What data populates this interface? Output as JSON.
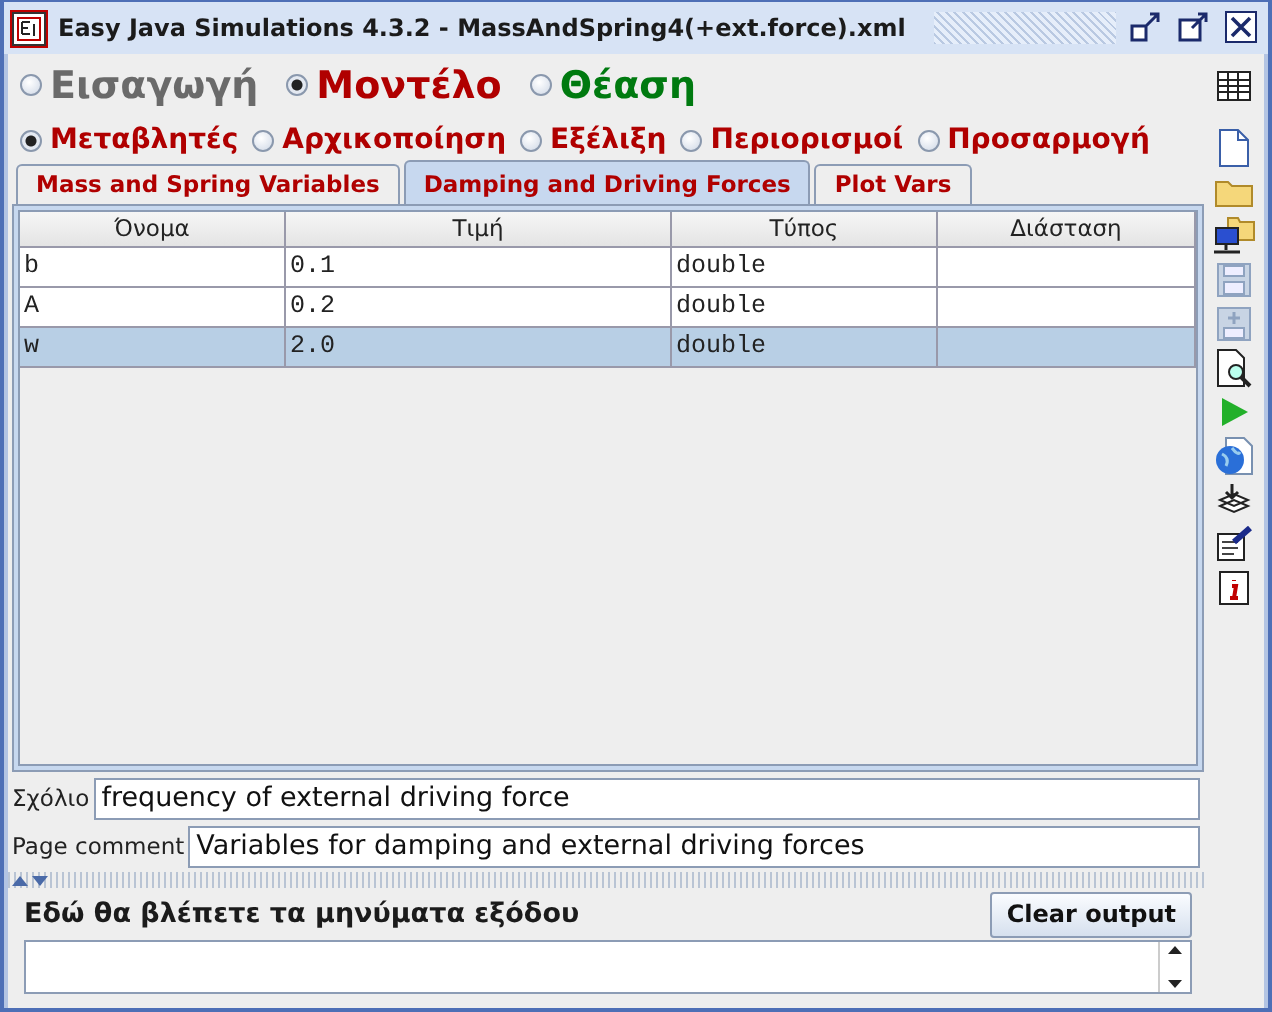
{
  "window": {
    "title": "Easy Java Simulations 4.3.2 - MassAndSpring4(+ext.force).xml"
  },
  "perspectives": [
    {
      "label": "Εισαγωγή",
      "selected": false,
      "color": "#6a6a6a"
    },
    {
      "label": "Μοντέλο",
      "selected": true,
      "color": "#b00000"
    },
    {
      "label": "Θέαση",
      "selected": false,
      "color": "#007a10"
    }
  ],
  "sections": [
    {
      "label": "Μεταβλητές",
      "selected": true
    },
    {
      "label": "Αρχικοποίηση",
      "selected": false
    },
    {
      "label": "Εξέλιξη",
      "selected": false
    },
    {
      "label": "Περιορισμοί",
      "selected": false
    },
    {
      "label": "Προσαρμογή",
      "selected": false
    }
  ],
  "tabs": [
    {
      "label": "Mass and Spring Variables",
      "selected": false
    },
    {
      "label": "Damping and Driving Forces",
      "selected": true
    },
    {
      "label": "Plot Vars",
      "selected": false
    }
  ],
  "table": {
    "columns": [
      "Όνομα",
      "Τιμή",
      "Τύπος",
      "Διάσταση"
    ],
    "rows": [
      {
        "cells": [
          "b",
          "0.1",
          "double",
          ""
        ],
        "selected": false
      },
      {
        "cells": [
          "A",
          "0.2",
          "double",
          ""
        ],
        "selected": false
      },
      {
        "cells": [
          "w",
          "2.0",
          "double",
          ""
        ],
        "selected": true
      }
    ]
  },
  "comment": {
    "label": "Σχόλιο",
    "value": "frequency of external driving force"
  },
  "page_comment": {
    "label": "Page comment",
    "value": "Variables for damping and external driving forces"
  },
  "output": {
    "label": "Εδώ θα βλέπετε τα μηνύματα εξόδου",
    "button": "Clear output"
  }
}
